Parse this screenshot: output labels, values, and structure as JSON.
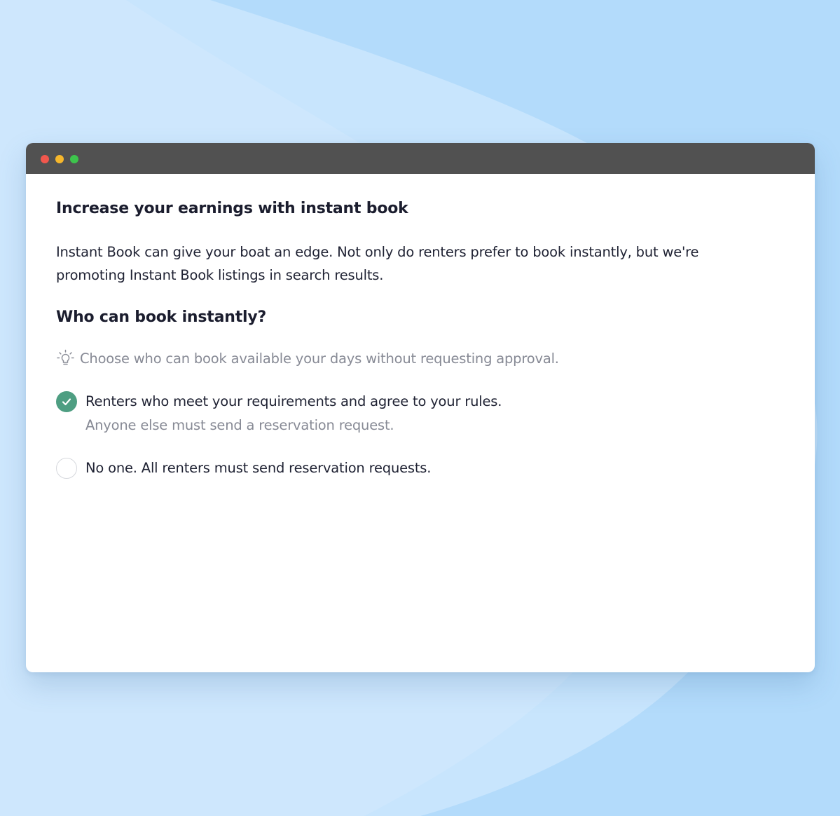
{
  "window": {
    "controls": [
      "close",
      "minimize",
      "maximize"
    ]
  },
  "content": {
    "title": "Increase your earnings with instant book",
    "description": "Instant Book can give your boat an edge. Not only do renters prefer to book instantly, but we're promoting Instant Book listings in search results.",
    "section_title": "Who can book instantly?",
    "tip": {
      "icon": "lightbulb-icon",
      "text": "Choose who can book available your days without requesting approval."
    },
    "options": [
      {
        "label": "Renters who meet your requirements and agree to your rules.",
        "sublabel": "Anyone else must send a reservation request.",
        "selected": true
      },
      {
        "label": "No one. All renters must send reservation requests.",
        "selected": false
      }
    ]
  },
  "colors": {
    "background": "#b3dbfb",
    "titlebar": "#515151",
    "accent_green": "#4e9e82",
    "close": "#f1574d",
    "minimize": "#f6b72c",
    "maximize": "#3dc44c"
  }
}
